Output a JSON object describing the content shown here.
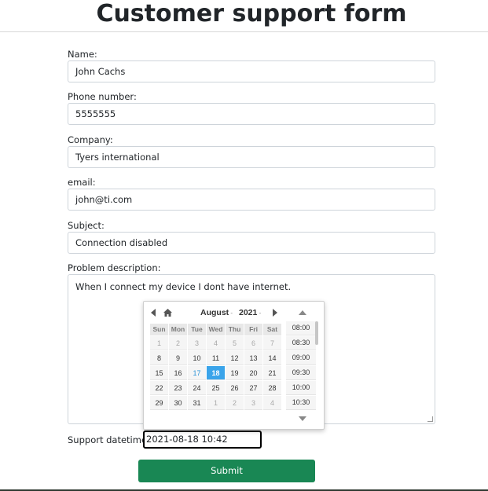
{
  "page": {
    "title": "Customer support form"
  },
  "form": {
    "name": {
      "label": "Name:",
      "value": "John Cachs"
    },
    "phone": {
      "label": "Phone number:",
      "value": "5555555"
    },
    "company": {
      "label": "Company:",
      "value": "Tyers international"
    },
    "email": {
      "label": "email:",
      "value": "john@ti.com"
    },
    "subject": {
      "label": "Subject:",
      "value": "Connection disabled"
    },
    "description": {
      "label": "Problem description:",
      "value": "When I connect my device I dont have internet."
    },
    "datetime": {
      "label": "Support datetime:",
      "value": "2021-08-18 10:42"
    },
    "submit_label": "Submit"
  },
  "picker": {
    "month": "August",
    "year": "2021",
    "weekdays": [
      "Sun",
      "Mon",
      "Tue",
      "Wed",
      "Thu",
      "Fri",
      "Sat"
    ],
    "weeks": [
      [
        {
          "d": "1",
          "o": true
        },
        {
          "d": "2",
          "o": true
        },
        {
          "d": "3",
          "o": true
        },
        {
          "d": "4",
          "o": true
        },
        {
          "d": "5",
          "o": true
        },
        {
          "d": "6",
          "o": true
        },
        {
          "d": "7",
          "o": true
        }
      ],
      [
        {
          "d": "8"
        },
        {
          "d": "9"
        },
        {
          "d": "10"
        },
        {
          "d": "11"
        },
        {
          "d": "12"
        },
        {
          "d": "13"
        },
        {
          "d": "14"
        }
      ],
      [
        {
          "d": "15"
        },
        {
          "d": "16"
        },
        {
          "d": "17",
          "today": true
        },
        {
          "d": "18",
          "sel": true
        },
        {
          "d": "19"
        },
        {
          "d": "20"
        },
        {
          "d": "21"
        }
      ],
      [
        {
          "d": "22"
        },
        {
          "d": "23"
        },
        {
          "d": "24"
        },
        {
          "d": "25"
        },
        {
          "d": "26"
        },
        {
          "d": "27"
        },
        {
          "d": "28"
        }
      ],
      [
        {
          "d": "29"
        },
        {
          "d": "30"
        },
        {
          "d": "31"
        },
        {
          "d": "1",
          "o": true
        },
        {
          "d": "2",
          "o": true
        },
        {
          "d": "3",
          "o": true
        },
        {
          "d": "4",
          "o": true
        }
      ]
    ],
    "times": [
      "08:00",
      "08:30",
      "09:00",
      "09:30",
      "10:00",
      "10:30"
    ],
    "icons": {
      "prev": "chevron-left-icon",
      "home": "home-icon",
      "next": "chevron-right-icon",
      "time_up": "triangle-up-icon",
      "time_down": "triangle-down-icon"
    }
  },
  "colors": {
    "submit_bg": "#198754",
    "selected_day": "#3aa4ea",
    "today_text": "#2c93d6"
  }
}
